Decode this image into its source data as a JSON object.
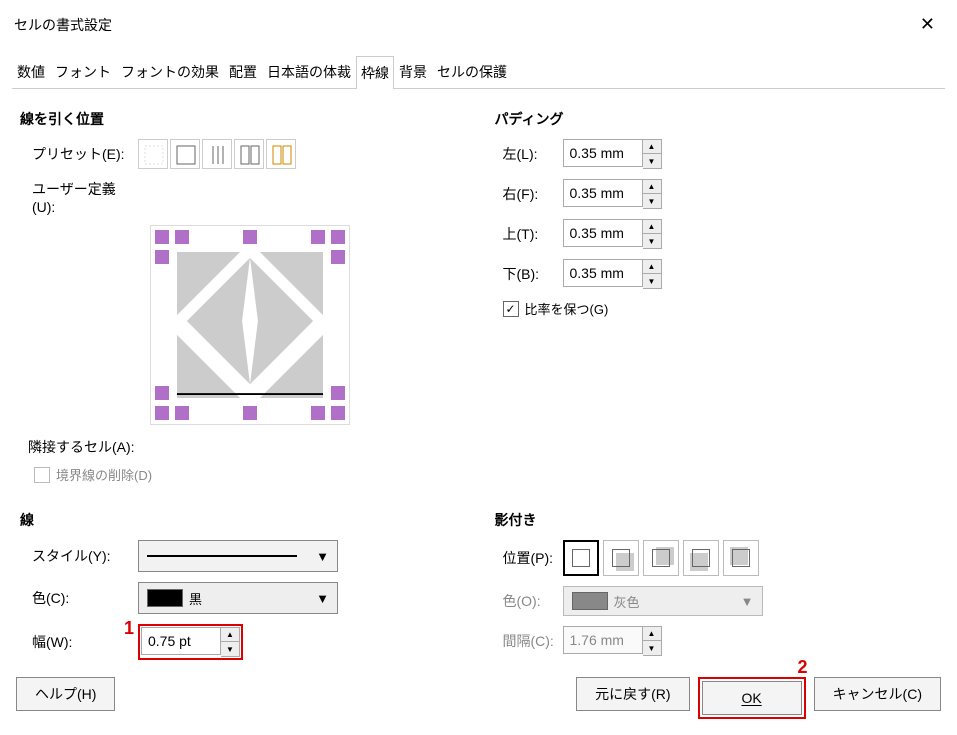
{
  "title": "セルの書式設定",
  "tabs": [
    "数値",
    "フォント",
    "フォントの効果",
    "配置",
    "日本語の体裁",
    "枠線",
    "背景",
    "セルの保護"
  ],
  "active_tab": 5,
  "line_pos": {
    "head": "線を引く位置",
    "preset": "プリセット(E):",
    "userdef": "ユーザー定義(U):",
    "adjacent": "隣接するセル(A):",
    "remove_border": "境界線の削除(D)"
  },
  "padding": {
    "head": "パディング",
    "left_l": "左(L):",
    "left_v": "0.35 mm",
    "right_l": "右(F):",
    "right_v": "0.35 mm",
    "top_l": "上(T):",
    "top_v": "0.35 mm",
    "bottom_l": "下(B):",
    "bottom_v": "0.35 mm",
    "keep_ratio": "比率を保つ(G)"
  },
  "line": {
    "head": "線",
    "style_l": "スタイル(Y):",
    "color_l": "色(C):",
    "color_v": "黒",
    "width_l": "幅(W):",
    "width_v": "0.75 pt"
  },
  "shadow": {
    "head": "影付き",
    "pos_l": "位置(P):",
    "color_l": "色(O):",
    "color_v": "灰色",
    "dist_l": "間隔(C):",
    "dist_v": "1.76 mm"
  },
  "buttons": {
    "help": "ヘルプ(H)",
    "reset": "元に戻す(R)",
    "ok": "OK",
    "cancel": "キャンセル(C)"
  },
  "annot": {
    "one": "1",
    "two": "2"
  }
}
